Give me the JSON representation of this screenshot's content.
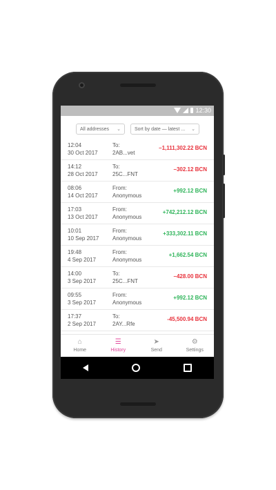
{
  "statusbar": {
    "time": "12:30"
  },
  "filters": {
    "address": "All addresses",
    "sort": "Sort by date — latest ..."
  },
  "transactions": [
    {
      "time": "12:04",
      "date": "30 Oct 2017",
      "direction": "To:",
      "party": "2AB...vet",
      "amount": "–1,111,302.22 BCN",
      "sign": "negative"
    },
    {
      "time": "14:12",
      "date": "28 Oct 2017",
      "direction": "To:",
      "party": "25C...FNT",
      "amount": "–302.12 BCN",
      "sign": "negative"
    },
    {
      "time": "08:06",
      "date": "14 Oct 2017",
      "direction": "From:",
      "party": "Anonymous",
      "amount": "+992.12 BCN",
      "sign": "positive"
    },
    {
      "time": "17:03",
      "date": "13 Oct 2017",
      "direction": "From:",
      "party": "Anonymous",
      "amount": "+742,212.12 BCN",
      "sign": "positive"
    },
    {
      "time": "10:01",
      "date": "10 Sep 2017",
      "direction": "From:",
      "party": "Anonymous",
      "amount": "+333,302.11 BCN",
      "sign": "positive"
    },
    {
      "time": "19:48",
      "date": "4 Sep 2017",
      "direction": "From:",
      "party": "Anonymous",
      "amount": "+1,662.54 BCN",
      "sign": "positive"
    },
    {
      "time": "14:00",
      "date": "3 Sep 2017",
      "direction": "To:",
      "party": "25C...FNT",
      "amount": "–428.00 BCN",
      "sign": "negative"
    },
    {
      "time": "09:55",
      "date": "3 Sep 2017",
      "direction": "From:",
      "party": "Anonymous",
      "amount": "+992.12 BCN",
      "sign": "positive"
    },
    {
      "time": "17:37",
      "date": "2 Sep 2017",
      "direction": "To:",
      "party": "2AY...Rfe",
      "amount": "-45,500.94 BCN",
      "sign": "negative"
    }
  ],
  "tabs": [
    {
      "label": "Home",
      "icon": "home-icon",
      "active": false
    },
    {
      "label": "History",
      "icon": "list-icon",
      "active": true
    },
    {
      "label": "Send",
      "icon": "send-icon",
      "active": false
    },
    {
      "label": "Settings",
      "icon": "gear-icon",
      "active": false
    }
  ],
  "colors": {
    "accent": "#e0459a",
    "negative": "#e8323c",
    "positive": "#2fb45a"
  }
}
